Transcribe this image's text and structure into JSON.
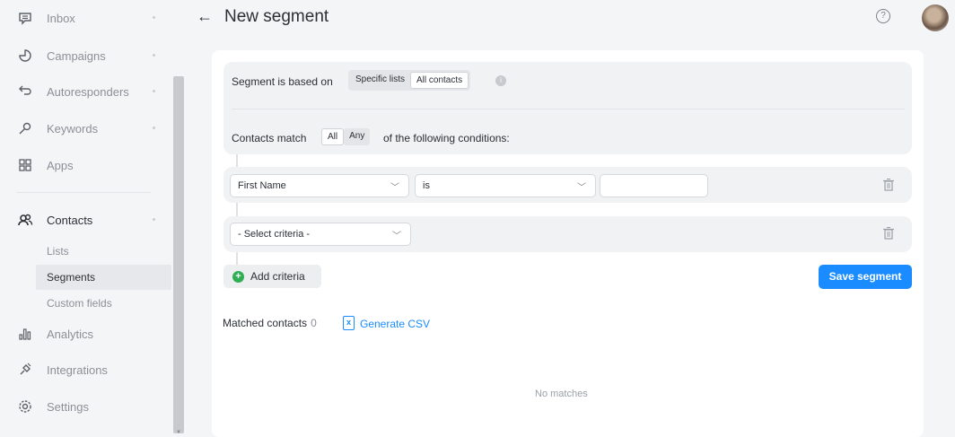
{
  "sidebar": {
    "items": [
      {
        "label": "Inbox",
        "icon": "inbox-icon"
      },
      {
        "label": "Campaigns",
        "icon": "campaigns-icon"
      },
      {
        "label": "Autoresponders",
        "icon": "autoresponders-icon"
      },
      {
        "label": "Keywords",
        "icon": "key-icon"
      },
      {
        "label": "Apps",
        "icon": "apps-grid-icon"
      },
      {
        "label": "Contacts",
        "icon": "contacts-icon"
      },
      {
        "label": "Analytics",
        "icon": "analytics-icon"
      },
      {
        "label": "Integrations",
        "icon": "integrations-icon"
      },
      {
        "label": "Settings",
        "icon": "gear-icon"
      }
    ],
    "contacts_sub": [
      "Lists",
      "Segments",
      "Custom fields"
    ]
  },
  "header": {
    "title": "New segment",
    "back_glyph": "←",
    "help_glyph": "?"
  },
  "segment": {
    "based_on_label": "Segment is based on",
    "based_on_options": [
      "Specific lists",
      "All contacts"
    ],
    "based_on_selected": "All contacts",
    "match_label": "Contacts match",
    "match_options": [
      "All",
      "Any"
    ],
    "match_selected": "All",
    "match_suffix": "of the following conditions:"
  },
  "criteria": [
    {
      "field": "First Name",
      "operator": "is",
      "value": ""
    },
    {
      "field": "- Select criteria -"
    }
  ],
  "actions": {
    "add_criteria": "Add criteria",
    "save_segment": "Save segment"
  },
  "results": {
    "matched_label": "Matched contacts",
    "matched_count": "0",
    "generate_csv": "Generate CSV",
    "empty_text": "No matches"
  },
  "colors": {
    "accent": "#1a8cff",
    "add_green": "#2fae54"
  }
}
